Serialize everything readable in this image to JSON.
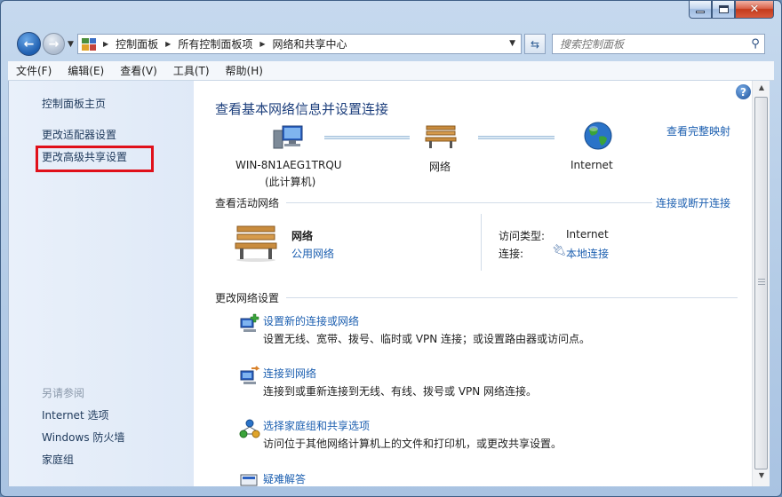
{
  "navbar": {
    "breadcrumb": [
      "控制面板",
      "所有控制面板项",
      "网络和共享中心"
    ],
    "search_placeholder": "搜索控制面板"
  },
  "menubar": [
    "文件(F)",
    "编辑(E)",
    "查看(V)",
    "工具(T)",
    "帮助(H)"
  ],
  "sidebar": {
    "links": [
      "控制面板主页",
      "更改适配器设置",
      "更改高级共享设置"
    ],
    "see_also_heading": "另请参阅",
    "see_also": [
      "Internet 选项",
      "Windows 防火墙",
      "家庭组"
    ]
  },
  "main": {
    "title": "查看基本网络信息并设置连接",
    "full_map_link": "查看完整映射",
    "map": {
      "computer_name": "WIN-8N1AEG1TRQU",
      "computer_sub": "(此计算机)",
      "network": "网络",
      "internet": "Internet"
    },
    "active": {
      "heading": "查看活动网络",
      "connect_link": "连接或断开连接",
      "network_name": "网络",
      "network_type": "公用网络",
      "access_label": "访问类型:",
      "access_value": "Internet",
      "conn_label": "连接:",
      "conn_value": "本地连接"
    },
    "change": {
      "heading": "更改网络设置",
      "tasks": [
        {
          "link": "设置新的连接或网络",
          "desc": "设置无线、宽带、拨号、临时或 VPN 连接；或设置路由器或访问点。"
        },
        {
          "link": "连接到网络",
          "desc": "连接到或重新连接到无线、有线、拨号或 VPN 网络连接。"
        },
        {
          "link": "选择家庭组和共享选项",
          "desc": "访问位于其他网络计算机上的文件和打印机，或更改共享设置。"
        },
        {
          "link": "疑难解答",
          "desc": ""
        }
      ]
    }
  },
  "colors": {
    "link": "#1c5fb0",
    "title": "#1d3f7c",
    "highlight": "#e0101a"
  }
}
